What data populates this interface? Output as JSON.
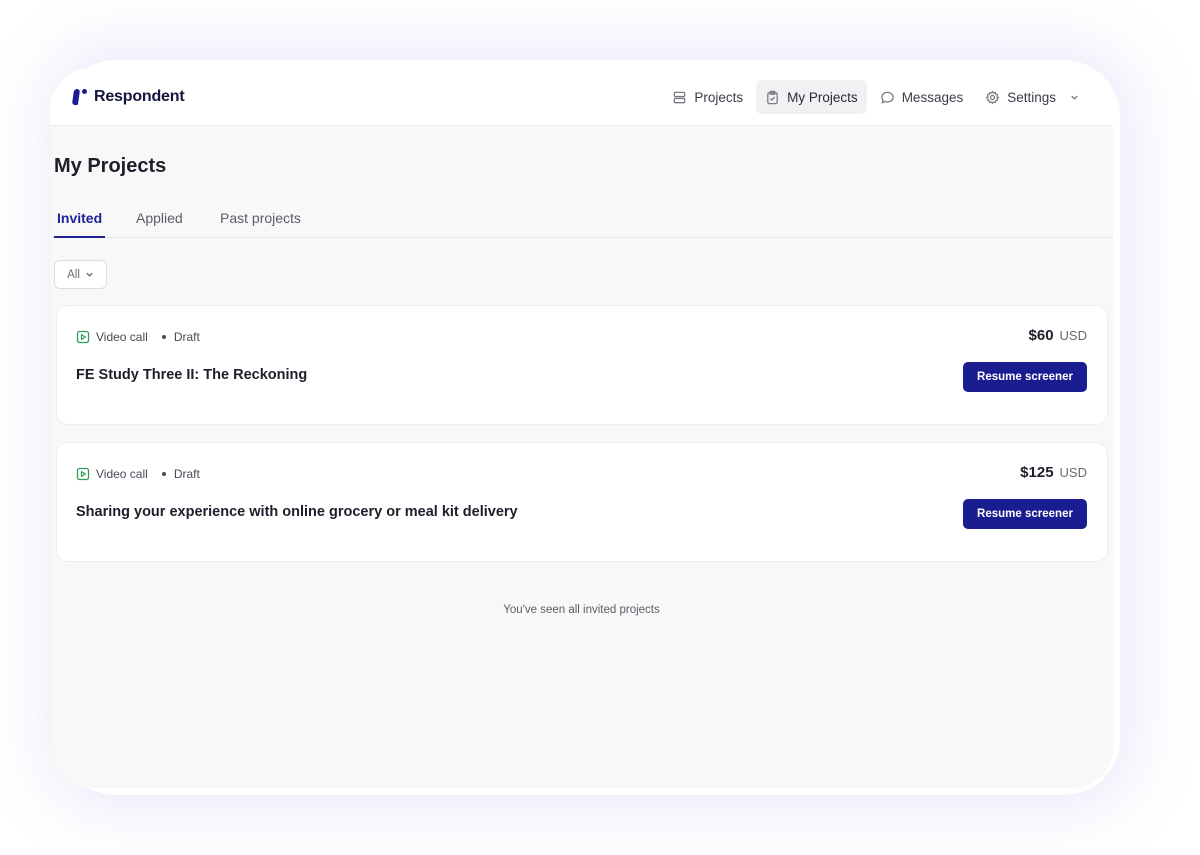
{
  "brand": {
    "name": "Respondent"
  },
  "nav": [
    {
      "label": "Projects",
      "icon": "projects-icon"
    },
    {
      "label": "My Projects",
      "icon": "clipboard-icon"
    },
    {
      "label": "Messages",
      "icon": "chat-bubble-icon"
    },
    {
      "label": "Settings",
      "icon": "gear-icon"
    }
  ],
  "page": {
    "title": "My Projects"
  },
  "tabs": [
    "Invited",
    "Applied",
    "Past projects"
  ],
  "filter": {
    "value": "All"
  },
  "projects": [
    {
      "type": "Video call",
      "status": "Draft",
      "title": "FE Study Three II: The Reckoning",
      "amount": "$60",
      "currency": "USD",
      "action": "Resume screener"
    },
    {
      "type": "Video call",
      "status": "Draft",
      "title": "Sharing your experience with online grocery or meal kit delivery",
      "amount": "$125",
      "currency": "USD",
      "action": "Resume screener"
    }
  ],
  "end_note": "You've seen all invited projects",
  "colors": {
    "brand": "#1a1d8f",
    "video_icon": "#2e9e5b",
    "page_bg": "#f8f8f9"
  }
}
